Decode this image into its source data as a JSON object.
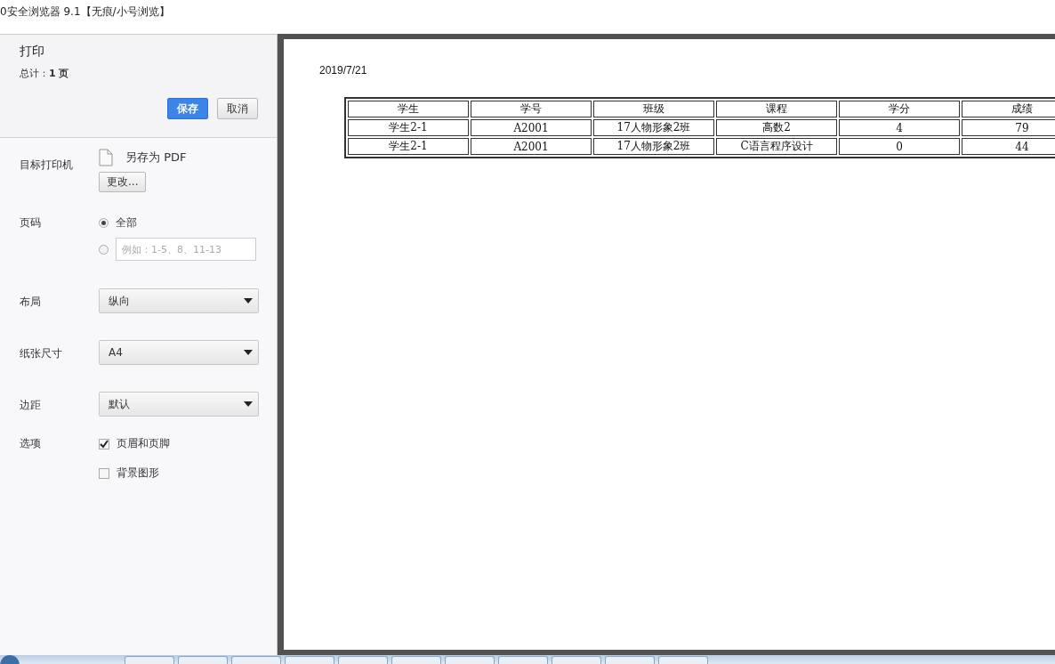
{
  "window": {
    "title": "0安全浏览器 9.1【无痕/小号浏览】"
  },
  "sidebar": {
    "title": "打印",
    "total": "总计：**1 页**",
    "buttons": [
      {
        "label": "保存",
        "kind": "primary"
      },
      {
        "label": "取消",
        "kind": "secondary"
      }
    ],
    "settings": [
      {
        "kind": "destination",
        "label": "目标打印机",
        "printer": "另存为 PDF",
        "button": "更改..."
      },
      {
        "kind": "pages",
        "label": "页码",
        "options": [
          {
            "label": "全部",
            "selected": true
          },
          {
            "placeholder": "例如：1-5、8、11-13",
            "selected": false
          }
        ]
      },
      {
        "kind": "select",
        "label": "布局",
        "value": "纵向"
      },
      {
        "kind": "select",
        "label": "纸张尺寸",
        "value": "A4"
      },
      {
        "kind": "select",
        "label": "边距",
        "value": "默认"
      },
      {
        "kind": "checks",
        "label": "选项",
        "options": [
          {
            "label": "页眉和页脚",
            "checked": true
          },
          {
            "label": "背景图形",
            "checked": false
          }
        ]
      }
    ]
  },
  "preview": {
    "date": "2019/7/21",
    "table": {
      "columns": [
        "学生",
        "学号",
        "班级",
        "课程",
        "学分",
        "成绩"
      ],
      "rows": [
        [
          "学生2-1",
          "A2001",
          "17人物形象2班",
          "高数2",
          "4",
          "79"
        ],
        [
          "学生2-1",
          "A2001",
          "17人物形象2班",
          "C语言程序设计",
          "0",
          "44"
        ]
      ]
    }
  }
}
